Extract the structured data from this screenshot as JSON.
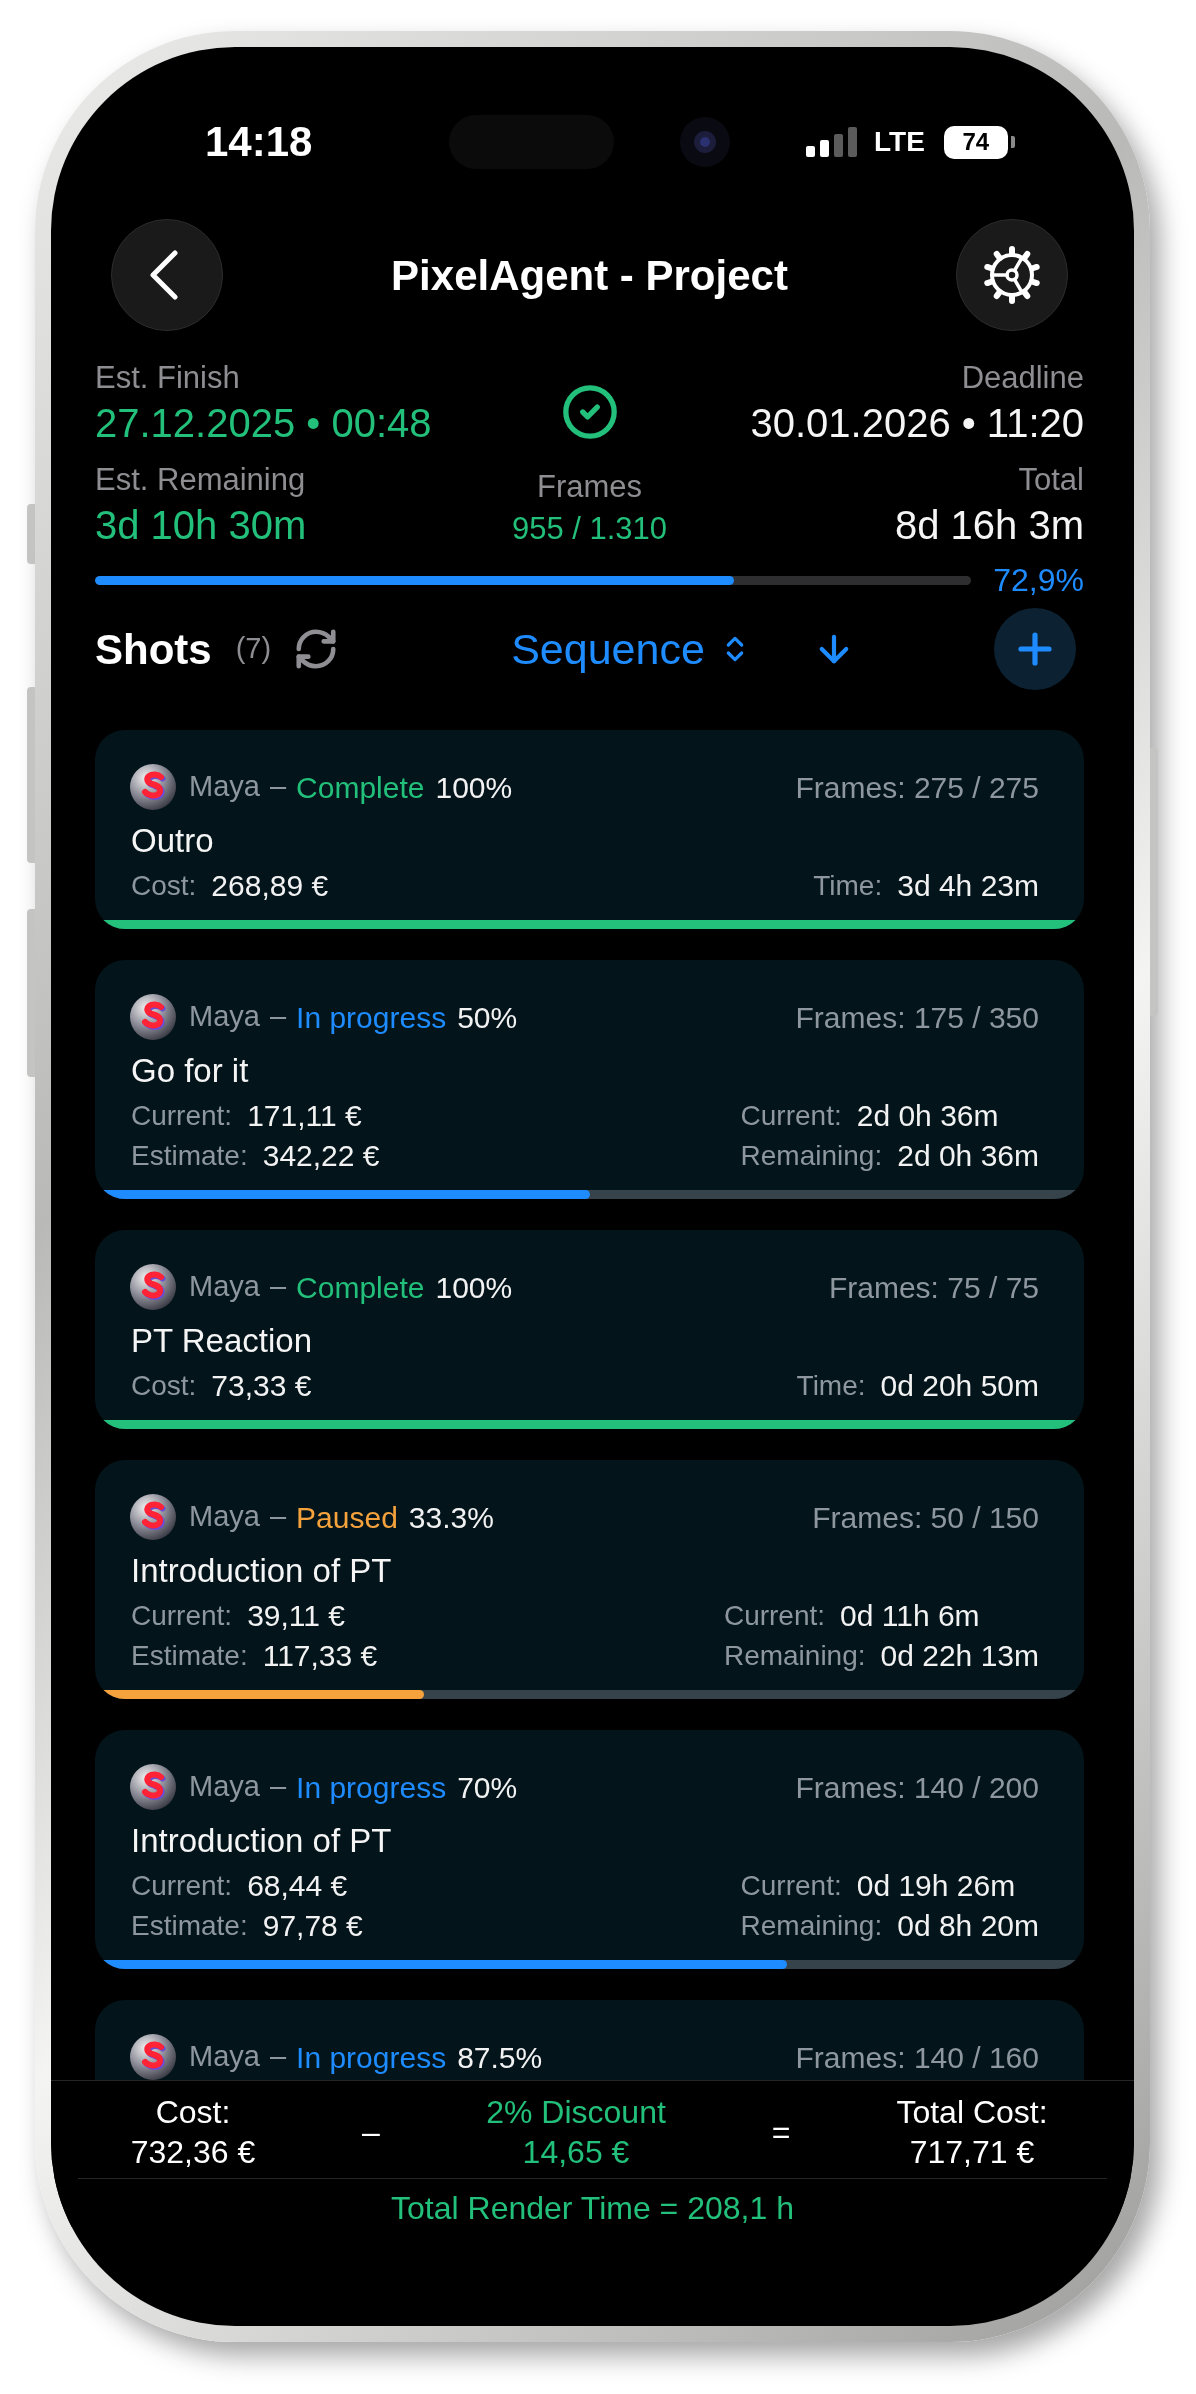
{
  "status_bar": {
    "time": "14:18",
    "network": "LTE",
    "battery": "74"
  },
  "header": {
    "title": "PixelAgent - Project"
  },
  "summary": {
    "est_finish": {
      "label": "Est. Finish",
      "value": "27.12.2025 • 00:48"
    },
    "est_remaining": {
      "label": "Est. Remaining",
      "value": "3d 10h 30m"
    },
    "frames": {
      "label": "Frames",
      "value": "955 / 1.310"
    },
    "deadline": {
      "label": "Deadline",
      "value": "30.01.2026 • 11:20"
    },
    "total": {
      "label": "Total",
      "value": "8d 16h 3m"
    },
    "progress": {
      "level": 0.729,
      "reading": "72,9%"
    }
  },
  "shots": {
    "title": "Shots",
    "count": "(7)",
    "sort": "Sequence"
  },
  "cards": [
    {
      "app": "Maya",
      "separator": "–",
      "status": {
        "label": "Complete",
        "color": "#22c07a"
      },
      "percent": "100%",
      "frames": "Frames: 275 / 275",
      "title": "Outro",
      "left": [
        {
          "label": "Cost:",
          "value": "268,89 €"
        }
      ],
      "right": [
        {
          "label": "Time:",
          "value": "3d 4h 23m"
        }
      ],
      "level": 1
    },
    {
      "app": "Maya",
      "separator": "–",
      "status": {
        "label": "In progress",
        "color": "#1e8cff"
      },
      "percent": "50%",
      "frames": "Frames: 175 / 350",
      "title": "Go for it",
      "left": [
        {
          "label": "Current:",
          "value": "171,11 €"
        },
        {
          "label": "Estimate:",
          "value": "342,22 €"
        }
      ],
      "right": [
        {
          "label": "Current:",
          "value": "2d 0h 36m"
        },
        {
          "label": "Remaining:",
          "value": "2d 0h 36m"
        }
      ],
      "level": 0.5
    },
    {
      "app": "Maya",
      "separator": "–",
      "status": {
        "label": "Complete",
        "color": "#22c07a"
      },
      "percent": "100%",
      "frames": "Frames: 75 / 75",
      "title": "PT Reaction",
      "left": [
        {
          "label": "Cost:",
          "value": "73,33 €"
        }
      ],
      "right": [
        {
          "label": "Time:",
          "value": "0d 20h 50m"
        }
      ],
      "level": 1
    },
    {
      "app": "Maya",
      "separator": "–",
      "status": {
        "label": "Paused",
        "color": "#f5a23d"
      },
      "percent": "33.3%",
      "frames": "Frames: 50 / 150",
      "title": "Introduction of PT",
      "left": [
        {
          "label": "Current:",
          "value": "39,11 €"
        },
        {
          "label": "Estimate:",
          "value": "117,33 €"
        }
      ],
      "right": [
        {
          "label": "Current:",
          "value": "0d 11h 6m"
        },
        {
          "label": "Remaining:",
          "value": "0d 22h 13m"
        }
      ],
      "level": 0.333
    },
    {
      "app": "Maya",
      "separator": "–",
      "status": {
        "label": "In progress",
        "color": "#1e8cff"
      },
      "percent": "70%",
      "frames": "Frames: 140 / 200",
      "title": "Introduction of PT",
      "left": [
        {
          "label": "Current:",
          "value": "68,44 €"
        },
        {
          "label": "Estimate:",
          "value": "97,78 €"
        }
      ],
      "right": [
        {
          "label": "Current:",
          "value": "0d 19h 26m"
        },
        {
          "label": "Remaining:",
          "value": "0d 8h 20m"
        }
      ],
      "level": 0.7
    },
    {
      "app": "Maya",
      "separator": "–",
      "status": {
        "label": "In progress",
        "color": "#1e8cff"
      },
      "percent": "87.5%",
      "frames": "Frames: 140 / 160"
    }
  ],
  "footer": {
    "cost": {
      "label": "Cost:",
      "value": "732,36 €"
    },
    "minus": "–",
    "discount": {
      "label": "2% Discount",
      "value": "14,65 €"
    },
    "equals": "=",
    "total": {
      "label": "Total Cost:",
      "value": "717,71 €"
    },
    "render_time": "Total Render Time = 208,1 h"
  }
}
